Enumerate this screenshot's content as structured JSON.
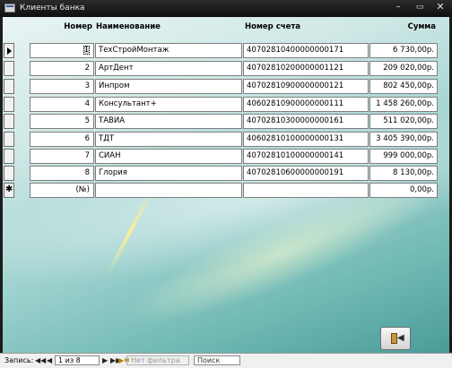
{
  "window": {
    "title": "Клиенты банка",
    "controls": {
      "minimize": "–",
      "maximize": "▭",
      "close": "✕"
    }
  },
  "table": {
    "columns": [
      "Номер",
      "Наименование",
      "Номер счета",
      "Сумма"
    ],
    "rows": [
      {
        "num": "1",
        "name": "ТехСтройМонтаж",
        "account": "40702810400000000171",
        "sum": "6 730,00р."
      },
      {
        "num": "2",
        "name": "АртДент",
        "account": "40702810200000001121",
        "sum": "209 020,00р."
      },
      {
        "num": "3",
        "name": "Инпром",
        "account": "40702810900000000121",
        "sum": "802 450,00р."
      },
      {
        "num": "4",
        "name": "Консультант+",
        "account": "40602810900000000111",
        "sum": "1 458 260,00р."
      },
      {
        "num": "5",
        "name": "ТАВИА",
        "account": "40702810300000000161",
        "sum": "511 020,00р."
      },
      {
        "num": "6",
        "name": "ТДТ",
        "account": "40602810100000000131",
        "sum": "3 405 390,00р."
      },
      {
        "num": "7",
        "name": "СИАН",
        "account": "40702810100000000141",
        "sum": "999 000,00р."
      },
      {
        "num": "8",
        "name": "Глория",
        "account": "40702810600000000191",
        "sum": "8 130,00р."
      }
    ],
    "new_row": {
      "marker": "✱",
      "num": "(№)",
      "sum": "0,00р."
    }
  },
  "navigation": {
    "label": "Запись:",
    "first": "◀◀",
    "prev": "◀",
    "position": "1 из 8",
    "next": "▶",
    "last": "▶▶",
    "new": "▶✱",
    "filter": "Нет фильтра",
    "search": "Поиск"
  },
  "icons": {
    "close_form_button": "exit-door-icon"
  }
}
